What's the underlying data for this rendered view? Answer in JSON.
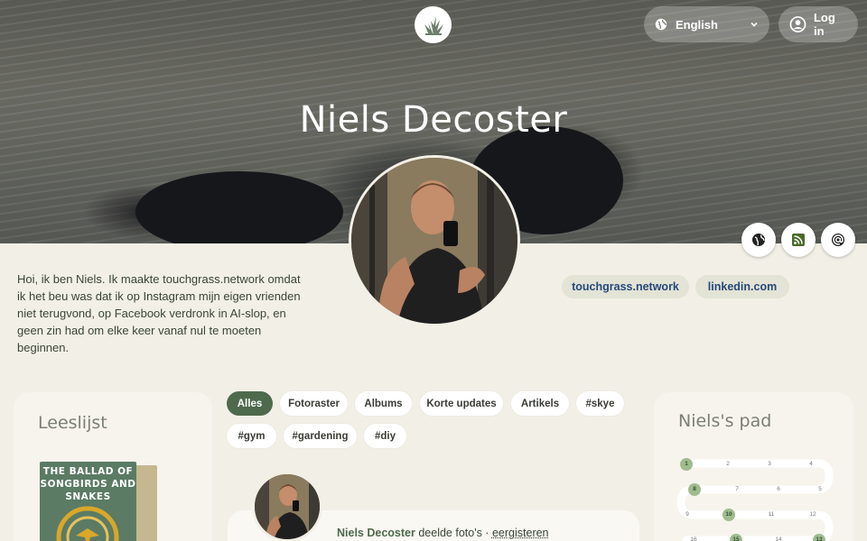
{
  "header": {
    "language_label": "English",
    "login_label": "Log in",
    "profile_name": "Niels Decoster"
  },
  "bio": "Hoi, ik ben Niels. Ik maakte touchgrass.network omdat ik het beu was dat ik op Instagram mijn eigen vrienden niet terugvond, op Facebook verdronk in AI-slop, en geen zin had om elke keer vanaf nul te moeten beginnen.",
  "links": [
    "touchgrass.network",
    "linkedin.com"
  ],
  "reading_list": {
    "title": "Leeslijst",
    "book_cover_text": "THE BALLAD OF SONGBIRDS AND SNAKES"
  },
  "filters": [
    "Alles",
    "Fotoraster",
    "Albums",
    "Korte updates",
    "Artikels",
    "#skye",
    "#gym",
    "#gardening",
    "#diy"
  ],
  "active_filter": "Alles",
  "post": {
    "author": "Niels Decoster",
    "action": "deelde foto's ·",
    "time": "eergisteren"
  },
  "path": {
    "title": "Niels's pad",
    "steps": [
      "1",
      "2",
      "3",
      "4",
      "8",
      "7",
      "6",
      "5",
      "9",
      "10",
      "11",
      "12",
      "16",
      "15",
      "14",
      "13"
    ],
    "completed": [
      "1",
      "8",
      "10",
      "15",
      "13"
    ]
  },
  "colors": {
    "accent": "#4e6a4d",
    "background": "#f2f0e6",
    "link": "#264a7a"
  },
  "icons": [
    "logo-grass-icon",
    "globe-icon",
    "chevron-down-icon",
    "user-circle-icon",
    "globe-icon",
    "rss-icon",
    "at-icon"
  ]
}
